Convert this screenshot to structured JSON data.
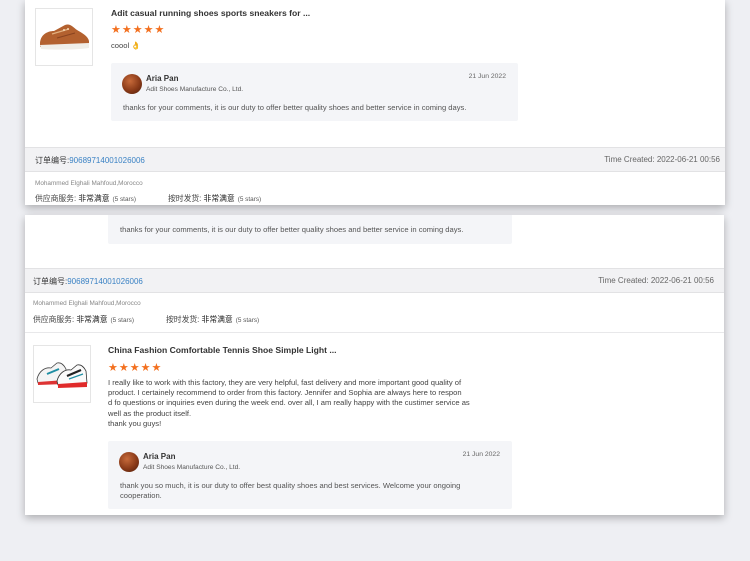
{
  "card1": {
    "product_title": "Adit casual running shoes sports sneakers for ...",
    "rating": 5,
    "review_text": "coool 👌",
    "reply": {
      "name": "Aria Pan",
      "company": "Adit Shoes Manufacture Co., Ltd.",
      "date": "21 Jun 2022",
      "text": "thanks for your comments,  it is our duty to offer better quality shoes and better service in coming days."
    },
    "order": {
      "label": "订单编号:",
      "number": "90689714001026006",
      "time": "Time Created: 2022-06-21 00:56"
    },
    "buyer": "Mohammed Elghali Mahfoud,Morocco",
    "service_label": "供应商服务:",
    "service_value": "非常满意",
    "service_stars": "(5 stars)",
    "shipping_label": "按时发货:",
    "shipping_value": "非常满意",
    "shipping_stars": "(5 stars)"
  },
  "card2": {
    "partial_reply_text": "thanks for your comments,  it is our duty to offer better quality shoes and better service in coming days.",
    "order": {
      "label": "订单编号:",
      "number": "90689714001026006",
      "time": "Time Created: 2022-06-21 00:56"
    },
    "buyer": "Mohammed Elghali Mahfoud,Morocco",
    "service_label": "供应商服务:",
    "service_value": "非常满意",
    "service_stars": "(5 stars)",
    "shipping_label": "按时发货:",
    "shipping_value": "非常满意",
    "shipping_stars": "(5 stars)",
    "product_title": "China Fashion Comfortable Tennis Shoe Simple Light ...",
    "rating": 5,
    "review_lines": [
      "I really like to work with this factory, they are very helpful, fast delivery and more important good quality of",
      "product. I certainely recommend to order from this factory. Jennifer and Sophia  are always here to respon",
      "d fo questions or inquiries even during the week end. over all, I am really happy with the custimer service as",
      "well as the product itself.",
      "thank you guys!"
    ],
    "reply": {
      "name": "Aria Pan",
      "company": "Adit Shoes Manufacture Co., Ltd.",
      "date": "21 Jun 2022",
      "text_lines": [
        "thank you so much, it is our duty to offer best quality shoes and best services. Welcome your ongoing",
        "cooperation."
      ]
    }
  },
  "icons": {
    "star": "star-icon",
    "avatar": "avatar",
    "product_1": "brown-sneaker-image",
    "product_2": "tennis-shoes-image"
  },
  "colors": {
    "star": "#f3701f",
    "order_number": "#3a82c4",
    "page_bg": "#eeeff3"
  }
}
